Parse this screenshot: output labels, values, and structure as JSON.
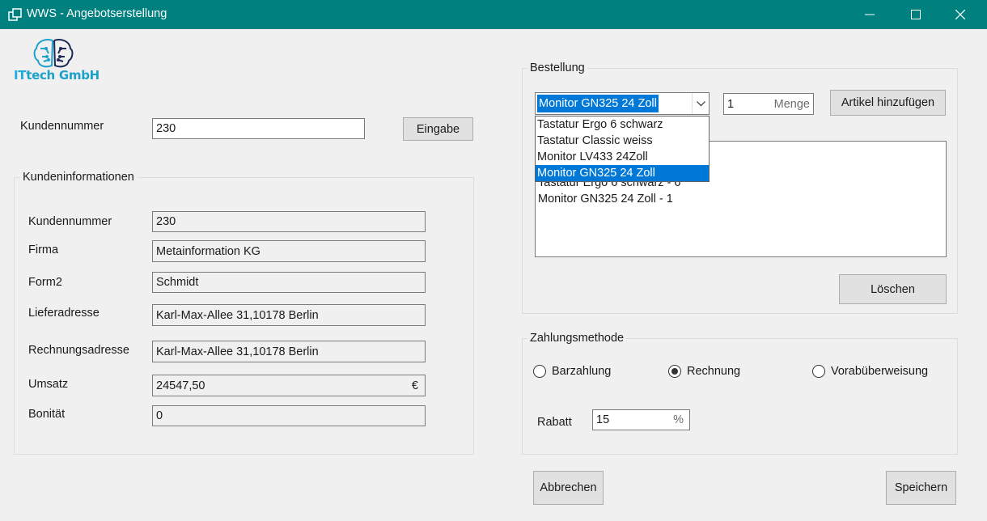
{
  "window": {
    "title": "WWS - Angebotserstellung",
    "titlebar_color": "#00807f",
    "icons": [
      "app-icon",
      "minimize-icon",
      "maximize-icon",
      "close-icon"
    ]
  },
  "logo": {
    "text_it": "IT",
    "text_rest": "tech GmbH"
  },
  "customer_entry": {
    "label": "Kundennummer",
    "value": "230",
    "button": "Eingabe"
  },
  "customer_info": {
    "group_title": "Kundeninformationen",
    "fields": [
      {
        "label": "Kundennummer",
        "value": "230"
      },
      {
        "label": "Firma",
        "value": "Metainformation KG"
      },
      {
        "label": "Form2",
        "value": "Schmidt"
      },
      {
        "label": "Lieferadresse",
        "value": "Karl-Max-Allee 31,10178 Berlin"
      },
      {
        "label": "Rechnungsadresse",
        "value": "Karl-Max-Allee 31,10178 Berlin"
      },
      {
        "label": "Umsatz",
        "value": "24547,50",
        "unit": "€"
      },
      {
        "label": "Bonität",
        "value": "0"
      }
    ]
  },
  "order": {
    "group_title": "Bestellung",
    "selected_article": "Monitor GN325 24 Zoll",
    "dropdown_options": [
      "Tastatur Ergo 6 schwarz",
      "Tastatur Classic weiss",
      "Monitor LV433 24Zoll",
      "Monitor GN325 24 Zoll"
    ],
    "quantity_value": "1",
    "quantity_hint": "Menge",
    "add_button": "Artikel hinzufügen",
    "items": [
      "Tastatur Ergo 6 schwarz  - 6",
      "Monitor GN325 24 Zoll  - 1"
    ],
    "delete_button": "Löschen"
  },
  "payment": {
    "group_title": "Zahlungsmethode",
    "options": [
      {
        "label": "Barzahlung",
        "checked": false
      },
      {
        "label": "Rechnung",
        "checked": true
      },
      {
        "label": "Vorabüberweisung",
        "checked": false
      }
    ],
    "discount_label": "Rabatt",
    "discount_value": "15",
    "discount_unit": "%"
  },
  "actions": {
    "cancel": "Abbrechen",
    "save": "Speichern"
  },
  "colors": {
    "selection": "#0078d7",
    "logo": "#1da1c9"
  }
}
